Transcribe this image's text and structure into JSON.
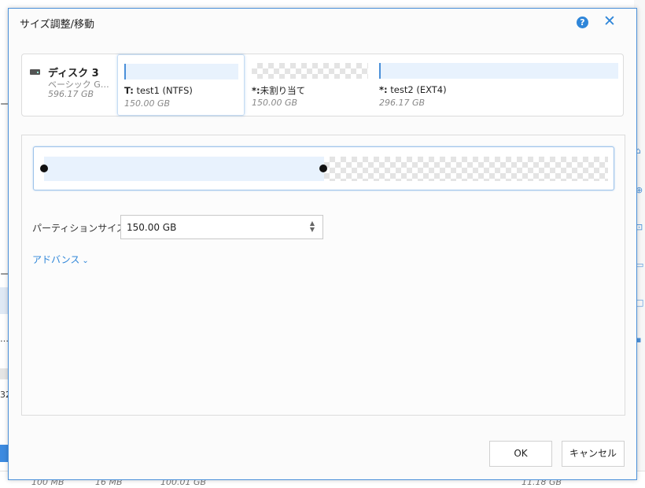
{
  "dialog": {
    "title": "サイズ調整/移動",
    "help_icon": "help-icon",
    "close_icon": "close-icon",
    "help_symbol": "?",
    "close_symbol": "✕"
  },
  "disk": {
    "name": "ディスク 3",
    "type": "ベーシック G…",
    "size": "596.17 GB",
    "icon": "disk-drive-icon"
  },
  "partitions": [
    {
      "letter": "T:",
      "name": "test1 (NTFS)",
      "size": "150.00 GB",
      "selected": true,
      "bar": "used"
    },
    {
      "letter": "*:",
      "name": "未割り当て",
      "size": "150.00 GB",
      "selected": false,
      "bar": "empty"
    },
    {
      "letter": "*:",
      "name": "test2 (EXT4)",
      "size": "296.17 GB",
      "selected": false,
      "bar": "used"
    }
  ],
  "resize": {
    "used_fraction": 0.5,
    "size_label": "パーティションサイズ:",
    "size_value": "150.00 GB",
    "spinner_up": "▲",
    "spinner_down": "▼",
    "advanced_label": "アドバンス",
    "advanced_icon": "chevron-down-icon",
    "advanced_symbol": "⌄"
  },
  "buttons": {
    "ok": "OK",
    "cancel": "キャンセル"
  },
  "background": {
    "footer_values": [
      "100 MB",
      "16 MB",
      "100.01 GB",
      "11.18 GB"
    ],
    "left_fragments": [
      "ー",
      "ー",
      "…",
      "32"
    ],
    "right_icons": [
      "⌂",
      "⊕",
      "⊡",
      "▭",
      "□",
      "▪"
    ]
  },
  "colors": {
    "accent": "#2f86d9",
    "partition_fill": "#e8f2fd",
    "border": "#dcdcdc"
  }
}
